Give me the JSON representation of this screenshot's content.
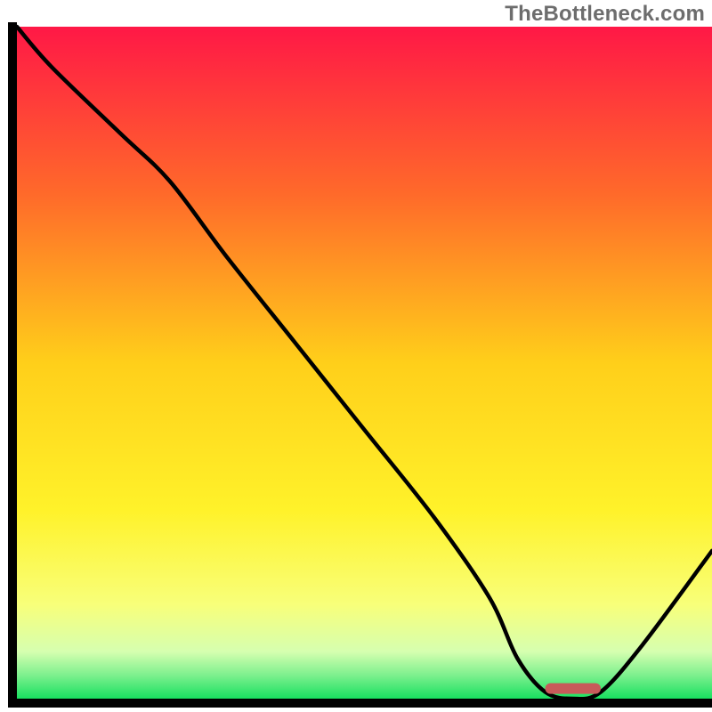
{
  "watermark": "TheBottleneck.com",
  "chart_data": {
    "type": "line",
    "title": "",
    "xlabel": "",
    "ylabel": "",
    "xlim": [
      0,
      100
    ],
    "ylim": [
      0,
      100
    ],
    "x": [
      0,
      5,
      15,
      22,
      30,
      40,
      50,
      60,
      68,
      72,
      76,
      80,
      84,
      90,
      100
    ],
    "values": [
      100,
      94,
      84,
      77,
      66,
      53,
      40,
      27,
      15,
      6,
      1,
      0,
      1,
      8,
      22
    ],
    "optimal_marker": {
      "x_start": 76,
      "x_end": 84,
      "y": 1.5
    },
    "gradient_stops": [
      {
        "offset": 0.0,
        "color": "#ff1846"
      },
      {
        "offset": 0.25,
        "color": "#ff6a2a"
      },
      {
        "offset": 0.5,
        "color": "#ffcf1a"
      },
      {
        "offset": 0.72,
        "color": "#fff22a"
      },
      {
        "offset": 0.86,
        "color": "#f8ff7a"
      },
      {
        "offset": 0.93,
        "color": "#d6ffb0"
      },
      {
        "offset": 0.965,
        "color": "#7df08e"
      },
      {
        "offset": 1.0,
        "color": "#18e060"
      }
    ]
  }
}
